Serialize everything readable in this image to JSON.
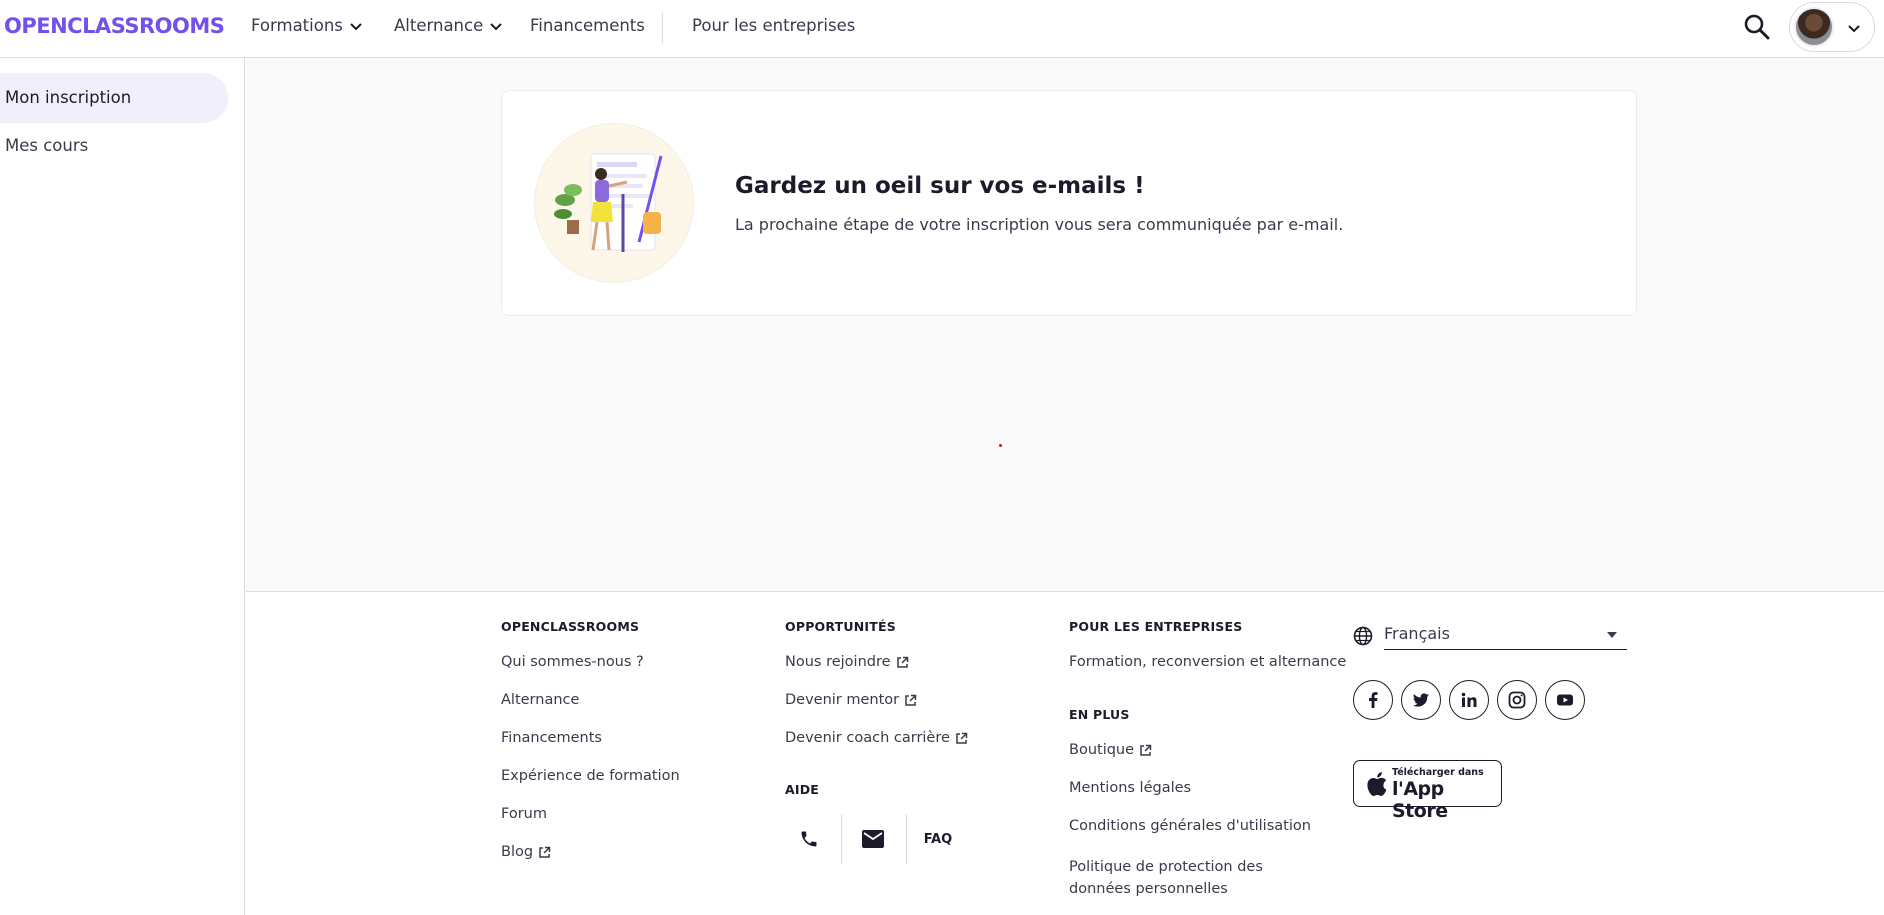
{
  "brand": {
    "logo_text": "OPENCLASSROOMS",
    "accent": "#7451eb"
  },
  "nav": {
    "items": [
      {
        "label": "Formations",
        "has_dropdown": true
      },
      {
        "label": "Alternance",
        "has_dropdown": true
      },
      {
        "label": "Financements",
        "has_dropdown": false
      },
      {
        "label": "Pour les entreprises",
        "has_dropdown": false
      }
    ],
    "search_icon": "search-icon",
    "account_icon": "avatar"
  },
  "sidebar": {
    "items": [
      {
        "label": "Mon inscription",
        "active": true
      },
      {
        "label": "Mes cours",
        "active": false
      }
    ]
  },
  "card": {
    "title": "Gardez un oeil sur vos e-mails !",
    "text": "La prochaine étape de votre inscription vous sera communiquée par e-mail."
  },
  "footer": {
    "col1": {
      "heading": "OPENCLASSROOMS",
      "links": [
        "Qui sommes-nous ?",
        "Alternance",
        "Financements",
        "Expérience de formation",
        "Forum",
        "Blog"
      ]
    },
    "col2": {
      "heading": "OPPORTUNITÉS",
      "links": [
        "Nous rejoindre",
        "Devenir mentor",
        "Devenir coach carrière"
      ],
      "help_heading": "AIDE",
      "faq_label": "FAQ"
    },
    "col3": {
      "heading": "POUR LES ENTREPRISES",
      "links": [
        "Formation, reconversion et alternance"
      ],
      "more_heading": "EN PLUS",
      "more_links": [
        "Boutique",
        "Mentions légales",
        "Conditions générales d'utilisation",
        "Politique de protection des données personnelles"
      ]
    },
    "language": {
      "selected": "Français"
    },
    "socials": [
      "facebook-icon",
      "twitter-icon",
      "linkedin-icon",
      "instagram-icon",
      "youtube-icon"
    ],
    "appstore": {
      "small": "Télécharger dans",
      "big": "l'App Store"
    }
  }
}
